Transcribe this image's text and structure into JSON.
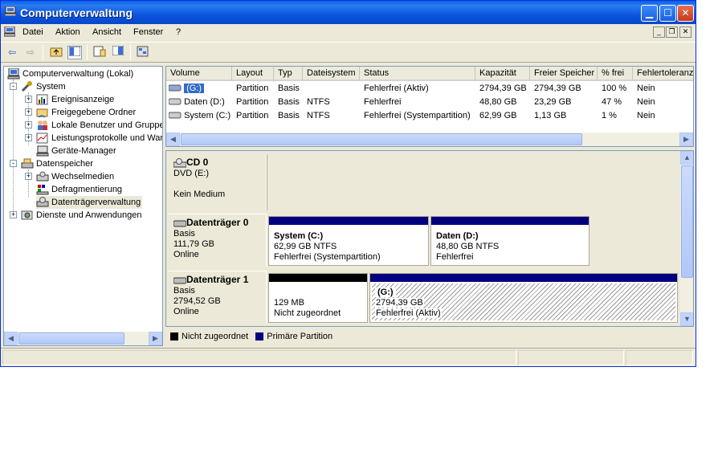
{
  "window": {
    "title": "Computerverwaltung"
  },
  "menu": {
    "items": [
      "Datei",
      "Aktion",
      "Ansicht",
      "Fenster",
      "?"
    ]
  },
  "tree": {
    "root": "Computerverwaltung (Lokal)",
    "items": [
      {
        "label": "System",
        "expander": "-"
      },
      {
        "label": "Ereignisanzeige",
        "expander": "+"
      },
      {
        "label": "Freigegebene Ordner",
        "expander": "+"
      },
      {
        "label": "Lokale Benutzer und Gruppe",
        "expander": "+"
      },
      {
        "label": "Leistungsprotokolle und War",
        "expander": "+"
      },
      {
        "label": "Geräte-Manager",
        "expander": ""
      },
      {
        "label": "Datenspeicher",
        "expander": "-"
      },
      {
        "label": "Wechselmedien",
        "expander": "+"
      },
      {
        "label": "Defragmentierung",
        "expander": ""
      },
      {
        "label": "Datenträgerverwaltung",
        "expander": ""
      },
      {
        "label": "Dienste und Anwendungen",
        "expander": "+"
      }
    ]
  },
  "volumes": {
    "columns": [
      "Volume",
      "Layout",
      "Typ",
      "Dateisystem",
      "Status",
      "Kapazität",
      "Freier Speicher",
      "% frei",
      "Fehlertoleranz"
    ],
    "rows": [
      [
        "(G:)",
        "Partition",
        "Basis",
        "",
        "Fehlerfrei (Aktiv)",
        "2794,39 GB",
        "2794,39 GB",
        "100 %",
        "Nein"
      ],
      [
        "Daten (D:)",
        "Partition",
        "Basis",
        "NTFS",
        "Fehlerfrei",
        "48,80 GB",
        "23,29 GB",
        "47 %",
        "Nein"
      ],
      [
        "System (C:)",
        "Partition",
        "Basis",
        "NTFS",
        "Fehlerfrei (Systempartition)",
        "62,99 GB",
        "1,13 GB",
        "1 %",
        "Nein"
      ]
    ]
  },
  "disks": [
    {
      "name": "CD 0",
      "line1": "DVD (E:)",
      "line2": "",
      "line3": "Kein Medium"
    },
    {
      "name": "Datenträger 0",
      "line1": "Basis",
      "line2": "111,79 GB",
      "line3": "Online",
      "partitions": [
        {
          "title": "System  (C:)",
          "size": "62,99 GB NTFS",
          "status": "Fehlerfrei (Systempartition)"
        },
        {
          "title": "Daten  (D:)",
          "size": "48,80 GB NTFS",
          "status": "Fehlerfrei"
        }
      ]
    },
    {
      "name": "Datenträger 1",
      "line1": "Basis",
      "line2": "2794,52 GB",
      "line3": "Online",
      "partitions": [
        {
          "title": "",
          "size": "129 MB",
          "status": "Nicht zugeordnet"
        },
        {
          "title": "(G:)",
          "size": "2794,39 GB",
          "status": "Fehlerfrei (Aktiv)"
        }
      ]
    }
  ],
  "legend": {
    "unallocated": "Nicht zugeordnet",
    "primary": "Primäre Partition"
  },
  "colors": {
    "primary": "#00007f",
    "unallocated": "#000000",
    "titlebar": "#0b55e0",
    "selection": "#316ac5"
  }
}
